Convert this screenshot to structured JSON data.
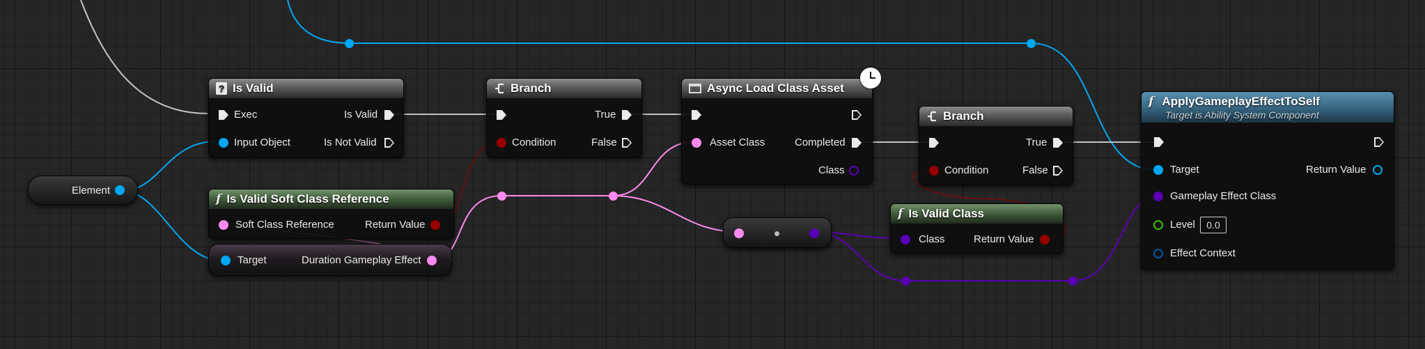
{
  "nodes": {
    "element": {
      "label": "Element"
    },
    "is_valid": {
      "title": "Is Valid",
      "exec_in": "Exec",
      "input_object": "Input Object",
      "out_valid": "Is Valid",
      "out_not_valid": "Is Not Valid"
    },
    "branch_1": {
      "title": "Branch",
      "condition": "Condition",
      "true_label": "True",
      "false_label": "False"
    },
    "async_load": {
      "title": "Async Load Class Asset",
      "asset_class": "Asset Class",
      "completed": "Completed",
      "class_out": "Class"
    },
    "branch_2": {
      "title": "Branch",
      "condition": "Condition",
      "true_label": "True",
      "false_label": "False"
    },
    "is_valid_soft": {
      "title": "Is Valid Soft Class Reference",
      "input": "Soft Class Reference",
      "output": "Return Value"
    },
    "get_duration": {
      "target": "Target",
      "output": "Duration Gameplay Effect"
    },
    "is_valid_class": {
      "title": "Is Valid Class",
      "input": "Class",
      "output": "Return Value"
    },
    "apply_effect": {
      "title": "ApplyGameplayEffectToSelf",
      "subtitle": "Target is Ability System Component",
      "target": "Target",
      "return_value": "Return Value",
      "effect_class": "Gameplay Effect Class",
      "level": "Level",
      "level_value": "0.0",
      "effect_context": "Effect Context"
    }
  },
  "colors": {
    "exec": "#eaeaea",
    "object": "#00a8f4",
    "bool": "#950000",
    "soft_class": "#ff8aee",
    "class": "#5a00b4",
    "float": "#39c100",
    "struct": "#0056a8",
    "wire_gray": "#c4c4c4"
  },
  "icons": {
    "is_valid": "question-icon",
    "branch": "branch-icon",
    "async": "window-icon",
    "function": "function-icon",
    "latent": "clock-icon"
  }
}
